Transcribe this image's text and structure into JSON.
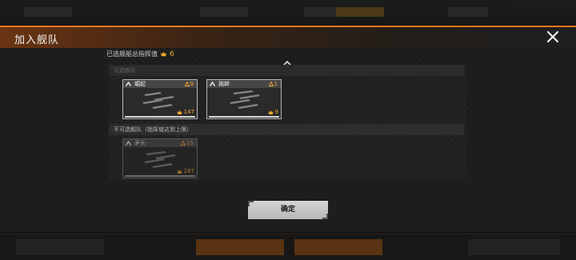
{
  "dialog": {
    "title": "加入舰队",
    "close_icon": "close-icon"
  },
  "info": {
    "label": "已选舰船总指挥值",
    "command_value": "6",
    "icon": "command-emblem-icon"
  },
  "sections": {
    "available": {
      "label": "可选舰队"
    },
    "unavailable": {
      "label": "不可选舰队（指挥值达到上限）"
    }
  },
  "ships": [
    {
      "name": "崛起",
      "cost": "9",
      "power": "147",
      "available": true
    },
    {
      "name": "挑衅",
      "cost": "1",
      "power": "9",
      "available": true
    },
    {
      "name": "矛头",
      "cost": "15",
      "power": "287",
      "available": false
    }
  ],
  "actions": {
    "confirm_label": "确定"
  },
  "colors": {
    "accent": "#e8781e",
    "value_gold": "#f0a830"
  }
}
